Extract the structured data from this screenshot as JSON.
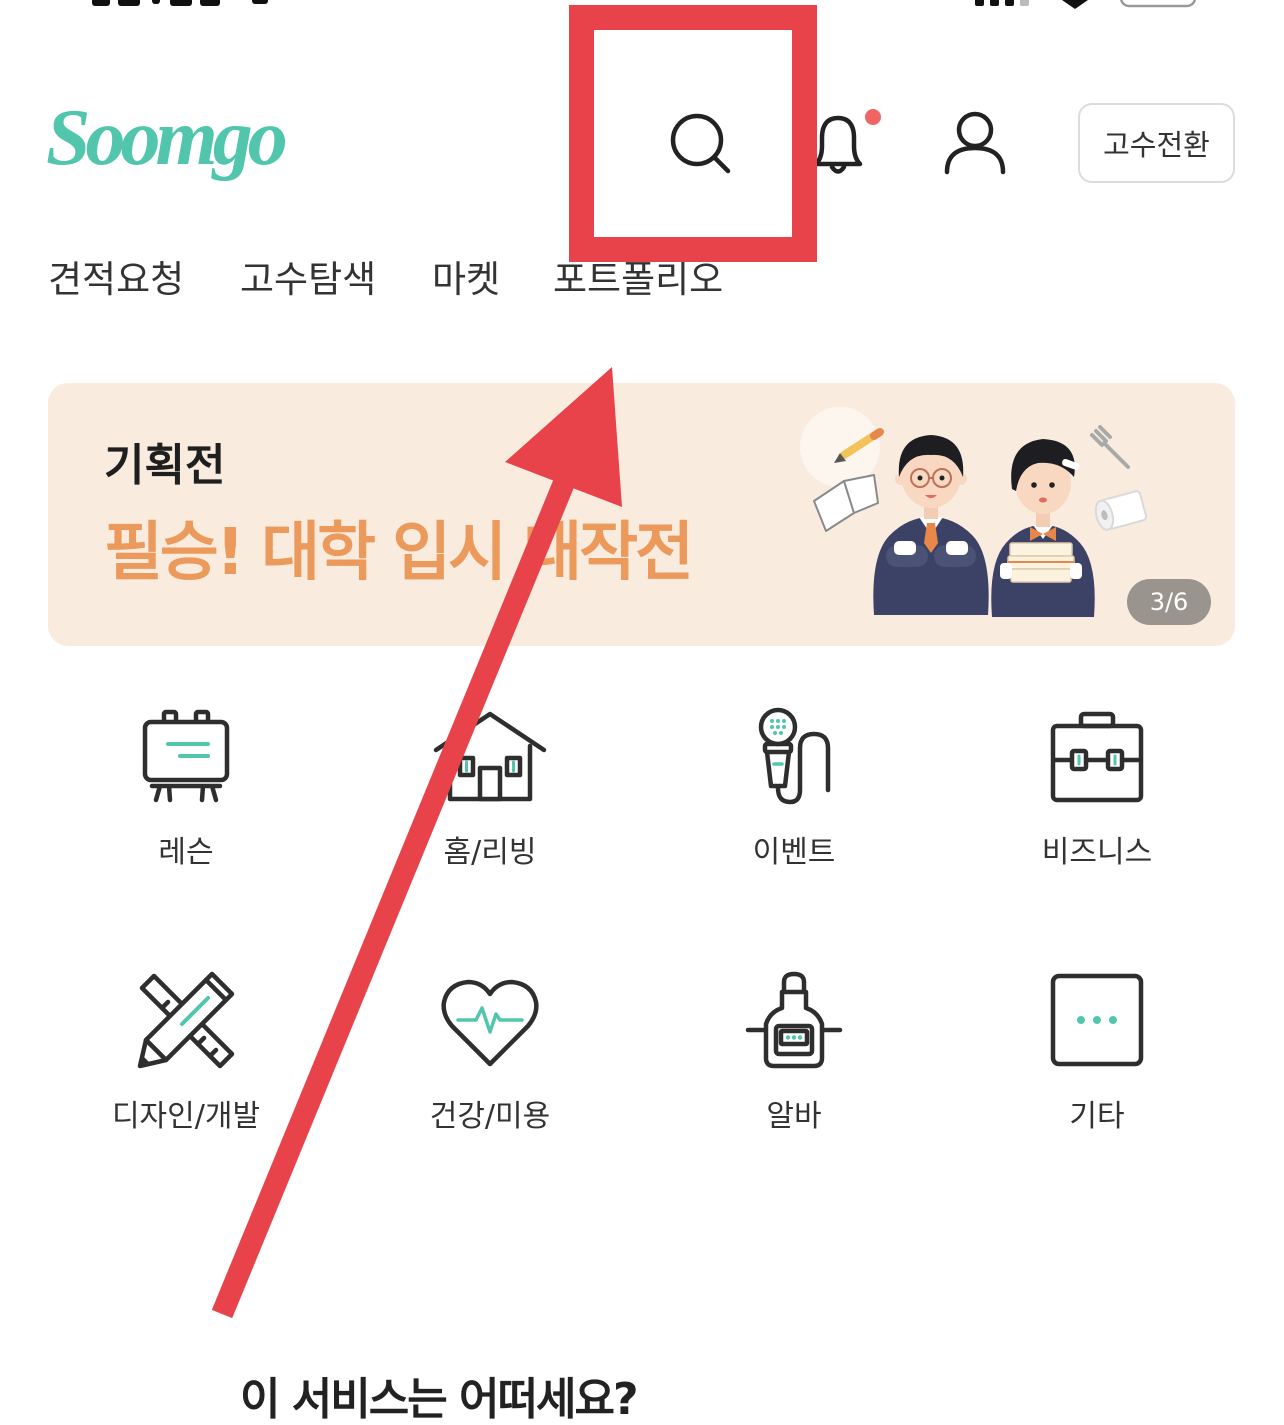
{
  "header": {
    "logo_text": "Soomgo",
    "search_icon": "search-icon",
    "notification_icon": "bell-icon",
    "profile_icon": "user-icon",
    "has_unread_notification": true,
    "switch_button_label": "고수전환"
  },
  "nav": {
    "tabs": [
      "견적요청",
      "고수탐색",
      "마켓",
      "포트폴리오"
    ]
  },
  "banner": {
    "tag": "기획전",
    "title": "필승! 대학 입시 대작전",
    "page_indicator": "3/6"
  },
  "categories": [
    {
      "label": "레슨",
      "icon": "easel-icon"
    },
    {
      "label": "홈/리빙",
      "icon": "house-icon"
    },
    {
      "label": "이벤트",
      "icon": "microphone-icon"
    },
    {
      "label": "비즈니스",
      "icon": "briefcase-icon"
    },
    {
      "label": "디자인/개발",
      "icon": "pencil-ruler-icon"
    },
    {
      "label": "건강/미용",
      "icon": "heart-pulse-icon"
    },
    {
      "label": "알바",
      "icon": "apron-icon"
    },
    {
      "label": "기타",
      "icon": "more-icon"
    }
  ],
  "recommendation_section": {
    "title": "이 서비스는 어떠세요?"
  },
  "colors": {
    "brand": "#52c5ad",
    "text": "#2b2b2b",
    "banner_background": "#f9ecdf",
    "banner_title": "#ec9a5c",
    "badge_background": "#9a948e",
    "notification_dot": "#f06464",
    "annotation": "#e8434b"
  }
}
